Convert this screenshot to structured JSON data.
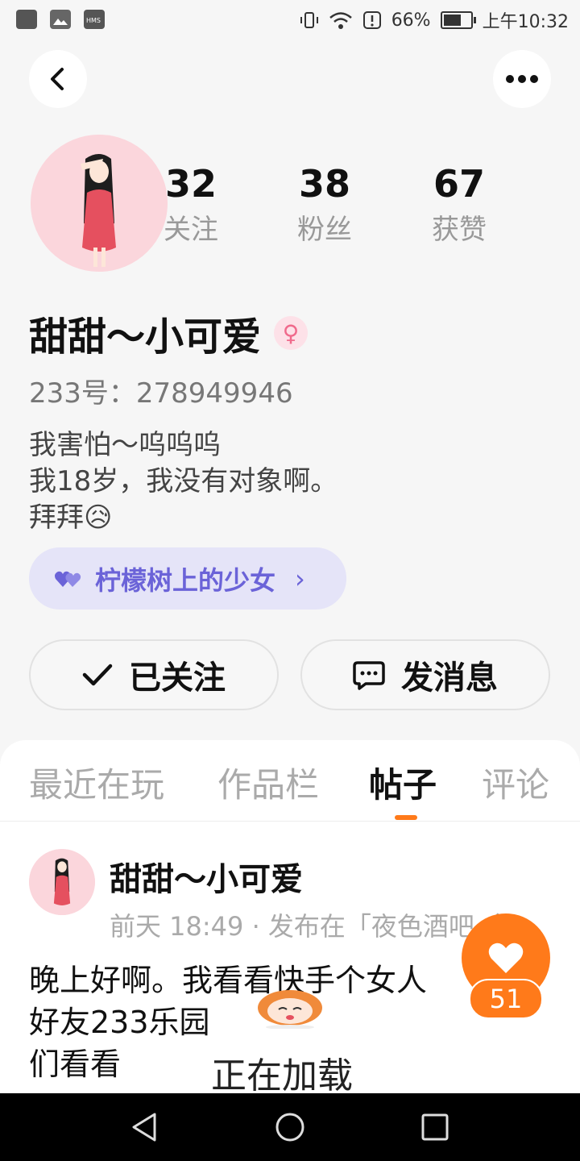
{
  "status_bar": {
    "battery_percent": "66%",
    "battery_level": 0.66,
    "time": "上午10:32",
    "left_icons": [
      "app-icon",
      "gallery-icon",
      "hms-icon"
    ],
    "right_icons": [
      "vibrate-icon",
      "wifi-icon",
      "alert-icon"
    ]
  },
  "header": {
    "back_icon": "chevron-left-icon",
    "more_icon": "more-dots-icon"
  },
  "profile": {
    "stats": [
      {
        "count": "32",
        "label": "关注"
      },
      {
        "count": "38",
        "label": "粉丝"
      },
      {
        "count": "67",
        "label": "获赞"
      }
    ],
    "name": "甜甜～小可爱",
    "gender_icon": "female-icon",
    "id_line": "233号：278949946",
    "bio": [
      "我害怕～呜呜呜",
      "我18岁，我没有对象啊。",
      "拜拜😥"
    ],
    "tag": {
      "icon": "hearts-icon",
      "label": "柠檬树上的少女",
      "chevron": "›"
    },
    "follow_label": "已关注",
    "message_label": "发消息"
  },
  "tabs": [
    {
      "label": "最近在玩",
      "active": false
    },
    {
      "label": "作品栏",
      "active": false
    },
    {
      "label": "帖子",
      "active": true
    },
    {
      "label": "评论",
      "active": false
    }
  ],
  "post": {
    "author": "甜甜～小可爱",
    "meta": "前天 18:49 · 发布在「夜色酒吧（…",
    "body": [
      "晚上好啊。我看看快手个女人",
      "好友233乐园",
      "们看看"
    ],
    "loading_text": "正在加载",
    "likes": "51"
  },
  "colors": {
    "accent": "#ff7a1a",
    "tag_bg": "#e5e4f8",
    "tag_text": "#6b63d8",
    "avatar_bg": "#fbd6dc"
  }
}
